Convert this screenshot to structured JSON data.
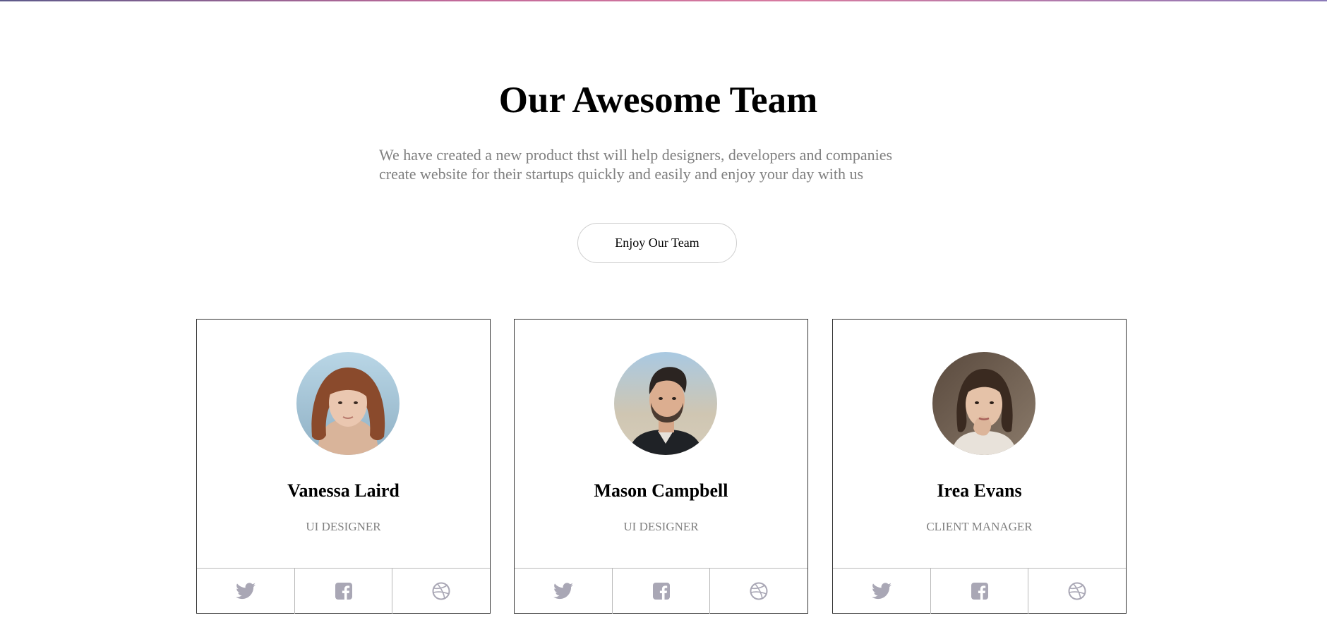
{
  "section": {
    "title": "Our Awesome Team",
    "subtitle_line1": "We have created a new product thst will help designers, developers and companies",
    "subtitle_line2": "create website for their startups quickly and easily and enjoy your day with us",
    "cta_label": "Enjoy Our Team"
  },
  "colors": {
    "title": "#000000",
    "muted_text": "#808080",
    "icon": "#a9a7b5",
    "card_border": "#333333"
  },
  "team": [
    {
      "name": "Vanessa Laird",
      "role": "UI DESIGNER",
      "avatar_icon": "woman-portrait-avatar",
      "social_icons": [
        "twitter-icon",
        "facebook-icon",
        "dribbble-icon"
      ]
    },
    {
      "name": "Mason Campbell",
      "role": "UI DESIGNER",
      "avatar_icon": "man-portrait-avatar",
      "social_icons": [
        "twitter-icon",
        "facebook-icon",
        "dribbble-icon"
      ]
    },
    {
      "name": "Irea Evans",
      "role": "CLIENT MANAGER",
      "avatar_icon": "woman-portrait-avatar",
      "social_icons": [
        "twitter-icon",
        "facebook-icon",
        "dribbble-icon"
      ]
    }
  ]
}
